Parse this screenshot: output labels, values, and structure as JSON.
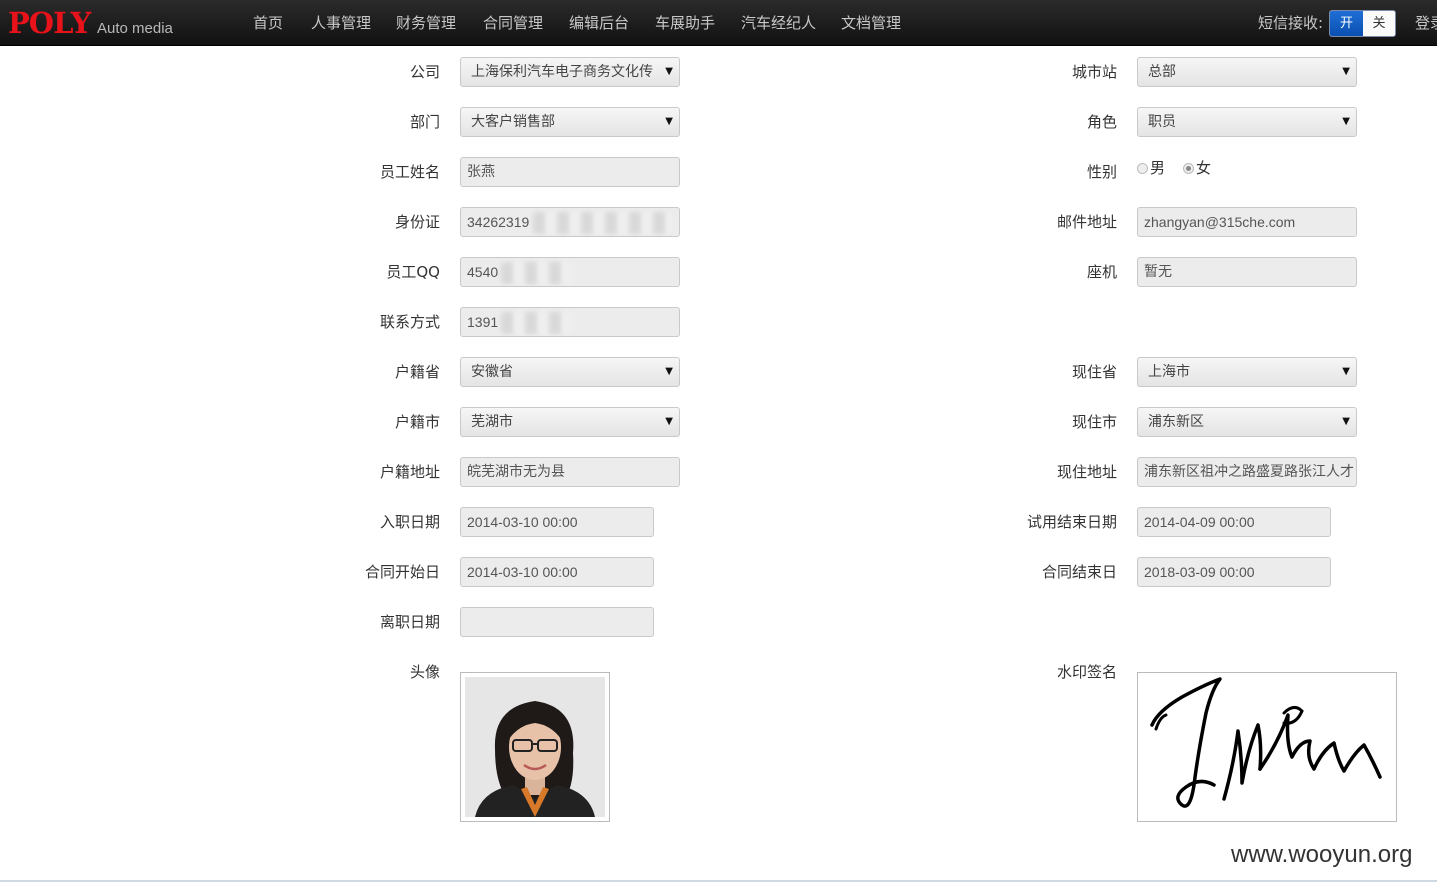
{
  "brand": {
    "logo": "POLY",
    "subtitle": "Auto media"
  },
  "nav": {
    "items": [
      "首页",
      "人事管理",
      "财务管理",
      "合同管理",
      "编辑后台",
      "车展助手",
      "汽车经纪人",
      "文档管理"
    ]
  },
  "sms": {
    "label": "短信接收:",
    "on": "开",
    "off": "关"
  },
  "login": "登录",
  "form": {
    "company": {
      "label": "公司",
      "value": "上海保利汽车电子商务文化传"
    },
    "city_station": {
      "label": "城市站",
      "value": "总部"
    },
    "department": {
      "label": "部门",
      "value": "大客户销售部"
    },
    "role": {
      "label": "角色",
      "value": "职员"
    },
    "name": {
      "label": "员工姓名",
      "value": "张燕"
    },
    "gender": {
      "label": "性别",
      "male": "男",
      "female": "女",
      "selected": "女"
    },
    "id_card": {
      "label": "身份证",
      "value": "34262319"
    },
    "email": {
      "label": "邮件地址",
      "value": "zhangyan@315che.com"
    },
    "qq": {
      "label": "员工QQ",
      "value": "4540"
    },
    "landline": {
      "label": "座机",
      "value": "暂无"
    },
    "phone": {
      "label": "联系方式",
      "value": "1391"
    },
    "hukou_province": {
      "label": "户籍省",
      "value": "安徽省"
    },
    "current_province": {
      "label": "现住省",
      "value": "上海市"
    },
    "hukou_city": {
      "label": "户籍市",
      "value": "芜湖市"
    },
    "current_city": {
      "label": "现住市",
      "value": "浦东新区"
    },
    "hukou_address": {
      "label": "户籍地址",
      "value": "皖芜湖市无为县"
    },
    "current_address": {
      "label": "现住地址",
      "value": "浦东新区祖冲之路盛夏路张江人才"
    },
    "hire_date": {
      "label": "入职日期",
      "value": "2014-03-10 00:00"
    },
    "probation_end": {
      "label": "试用结束日期",
      "value": "2014-04-09 00:00"
    },
    "contract_start": {
      "label": "合同开始日",
      "value": "2014-03-10 00:00"
    },
    "contract_end": {
      "label": "合同结束日",
      "value": "2018-03-09 00:00"
    },
    "leave_date": {
      "label": "离职日期",
      "value": ""
    },
    "avatar": {
      "label": "头像"
    },
    "signature": {
      "label": "水印签名"
    }
  },
  "watermark": "www.wooyun.org"
}
